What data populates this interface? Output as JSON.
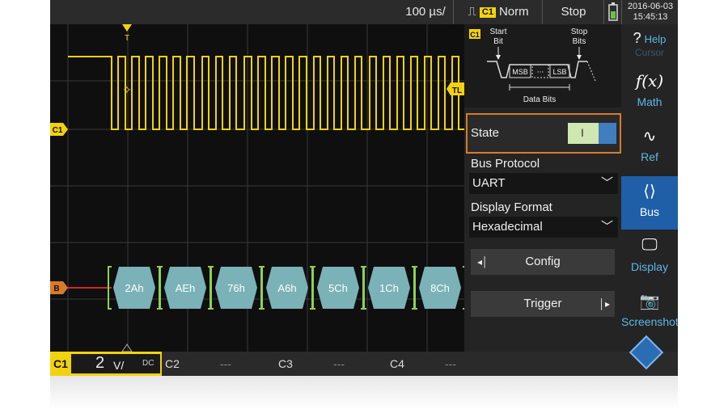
{
  "topbar": {
    "timebase": "100 µs/",
    "trigger_channel": "C1",
    "trigger_mode": "Norm",
    "run_state": "Stop",
    "date": "2016-06-03",
    "time": "15:45:13"
  },
  "plot": {
    "channel_marker": "C1",
    "bus_marker": "B",
    "trigger_level_marker": "TL",
    "trigger_pos_marker": "T",
    "bus_values": [
      "2Ah",
      "AEh",
      "76h",
      "A6h",
      "5Ch",
      "1Ch",
      "8Ch"
    ]
  },
  "protocol_diagram": {
    "channel": "C1",
    "start_bit": "Start\nBit",
    "stop_bits": "Stop\nBits",
    "msb": "MSB",
    "lsb": "LSB",
    "dots": "···",
    "data_bits": "Data Bits"
  },
  "panel": {
    "state_label": "State",
    "state_toggle": "I",
    "bus_protocol_label": "Bus Protocol",
    "bus_protocol_value": "UART",
    "display_format_label": "Display Format",
    "display_format_value": "Hexadecimal",
    "config_label": "Config",
    "trigger_label": "Trigger"
  },
  "sidebar": {
    "help": "Help",
    "cursor": "Cursor",
    "math": "Math",
    "ref": "Ref",
    "bus": "Bus",
    "display": "Display",
    "screenshot": "Screenshot"
  },
  "channels": {
    "c1": "C1",
    "c1_scale": "2",
    "c1_unit": "V/",
    "c1_coupling": "DC",
    "c2": "C2",
    "c2_val": "---",
    "c3": "C3",
    "c3_val": "---",
    "c4": "C4",
    "c4_val": "---"
  },
  "colors": {
    "c1": "#f2d20c",
    "bus": "#7ab2b8",
    "accent": "#1e5fa8",
    "highlight": "#d87a2c"
  }
}
